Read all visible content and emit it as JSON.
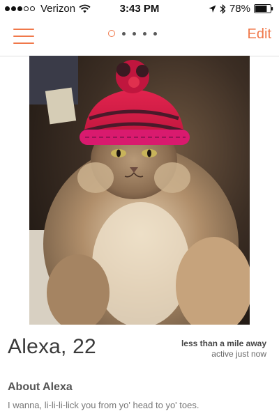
{
  "status_bar": {
    "carrier": "Verizon",
    "time": "3:43 PM",
    "battery": "78%",
    "signal_bars_filled": 3,
    "signal_bars_total": 5,
    "icons": [
      "signal-icon",
      "wifi-icon",
      "location-arrow-icon",
      "bluetooth-icon",
      "battery-icon"
    ]
  },
  "nav": {
    "edit_label": "Edit",
    "page_count": 5,
    "active_page": 1,
    "icons": [
      "menu-icon"
    ]
  },
  "colors": {
    "accent": "#f0784a",
    "name_text": "#3a3a3a"
  },
  "profile": {
    "name_age": "Alexa, 22",
    "distance": "less than a mile away",
    "activity": "active just now",
    "about_heading": "About Alexa",
    "bio": "I wanna, li-li-li-lick you from yo' head to yo' toes."
  }
}
